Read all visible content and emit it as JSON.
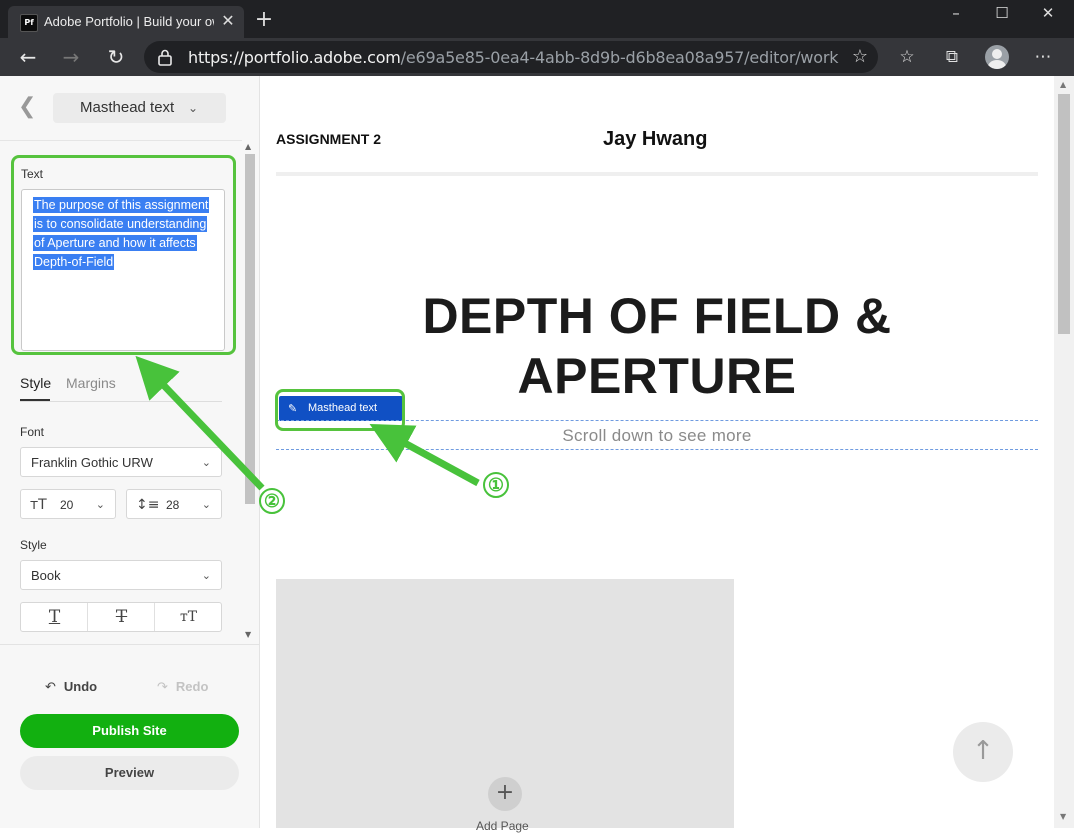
{
  "browser": {
    "tab_favicon": "Pf",
    "tab_title": "Adobe Portfolio | Build your own",
    "tab_close": "✕",
    "new_tab": "+",
    "url_host": "https://portfolio.adobe.com",
    "url_path": "/e69a5e85-0ea4-4abb-8d9b-d6b8ea08a957/editor/work",
    "icons": [
      "back-arrow-icon",
      "forward-arrow-icon",
      "refresh-icon",
      "lock-icon",
      "star-icon",
      "favorites-icon",
      "collections-icon",
      "profile-icon",
      "more-icon"
    ],
    "window_controls": {
      "minimize": "–",
      "maximize": "☐",
      "close": "✕"
    }
  },
  "sidebar": {
    "section_label": "Masthead text",
    "text_label": "Text",
    "text_value_lines": [
      "The purpose of this assignment",
      "is to consolidate understanding",
      "of Aperture and how it affects",
      "Depth-of-Field"
    ],
    "tabs": [
      "Style",
      "Margins"
    ],
    "font_label": "Font",
    "font_value": "Franklin Gothic URW",
    "font_size": "20",
    "line_height": "28",
    "style_label": "Style",
    "style_value": "Book",
    "undo_label": "Undo",
    "redo_label": "Redo",
    "publish_label": "Publish Site",
    "preview_label": "Preview"
  },
  "canvas": {
    "nav_title": "ASSIGNMENT 2",
    "owner_name": "Jay Hwang",
    "masthead_title_line1": "DEPTH OF FIELD &",
    "masthead_title_line2": "APERTURE",
    "masthead_tag_label": "Masthead text",
    "masthead_subtitle": "Scroll down to see more",
    "add_page_label": "Add Page"
  },
  "annotations": {
    "marker_1": "①",
    "marker_2": "②",
    "color": "#48c23b"
  },
  "colors": {
    "accent_blue": "#1050c4",
    "publish_green": "#12b010",
    "selection_blue": "#3a7ff2"
  }
}
